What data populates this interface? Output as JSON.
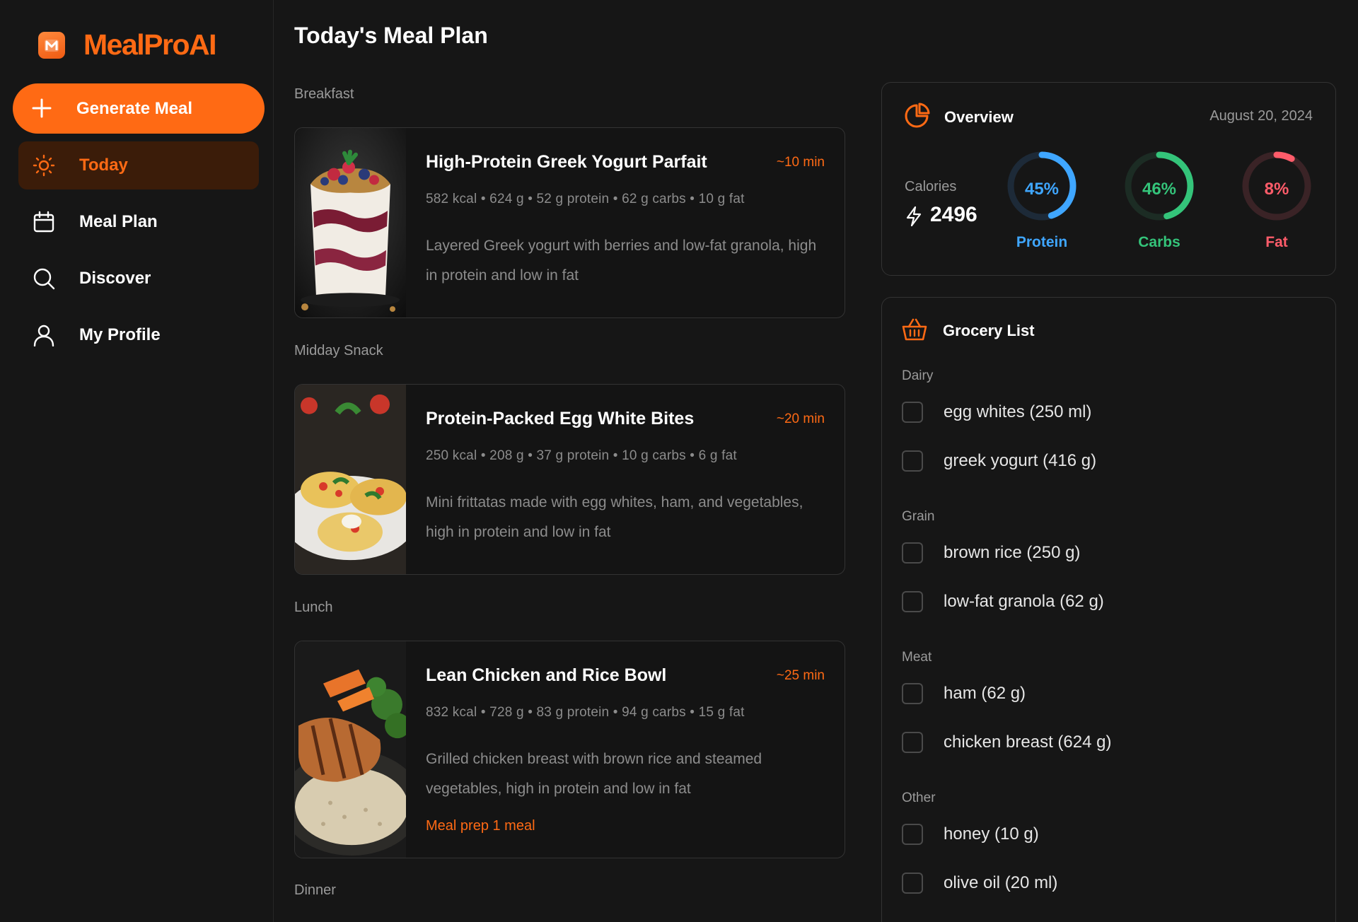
{
  "app": {
    "name": "MealProAI"
  },
  "sidebar": {
    "generate_label": "Generate Meal",
    "items": [
      {
        "label": "Today",
        "icon": "sun-icon",
        "active": true
      },
      {
        "label": "Meal Plan",
        "icon": "calendar-icon",
        "active": false
      },
      {
        "label": "Discover",
        "icon": "search-icon",
        "active": false
      },
      {
        "label": "My Profile",
        "icon": "user-icon",
        "active": false
      }
    ]
  },
  "main": {
    "title": "Today's Meal Plan",
    "sections": [
      {
        "label": "Breakfast",
        "meal": {
          "name": "High-Protein Greek Yogurt Parfait",
          "time": "~10 min",
          "stats": "582 kcal • 624 g • 52 g protein • 62 g carbs • 10 g fat",
          "desc": "Layered Greek yogurt with berries and low-fat granola, high in protein and low in fat",
          "image": "yogurt-parfait-image"
        }
      },
      {
        "label": "Midday Snack",
        "meal": {
          "name": "Protein-Packed Egg White Bites",
          "time": "~20 min",
          "stats": "250 kcal • 208 g • 37 g protein • 10 g carbs • 6 g fat",
          "desc": "Mini frittatas made with egg whites, ham, and vegetables, high in protein and low in fat",
          "image": "egg-white-bites-image"
        }
      },
      {
        "label": "Lunch",
        "meal": {
          "name": "Lean Chicken and Rice Bowl",
          "time": "~25 min",
          "stats": "832 kcal • 728 g • 83 g protein • 94 g carbs • 15 g fat",
          "desc": "Grilled chicken breast with brown rice and steamed vegetables, high in protein and low in fat",
          "prep": "Meal prep 1 meal",
          "image": "chicken-rice-bowl-image"
        }
      },
      {
        "label": "Dinner"
      }
    ]
  },
  "overview": {
    "title": "Overview",
    "date": "August 20, 2024",
    "calories_label": "Calories",
    "calories": "2496",
    "macros": [
      {
        "pct_text": "45%",
        "label": "Protein",
        "fraction": 0.45,
        "color": "#3fa6ff",
        "track": "#1d2a38"
      },
      {
        "pct_text": "46%",
        "label": "Carbs",
        "fraction": 0.46,
        "color": "#34c47a",
        "track": "#1c2c24"
      },
      {
        "pct_text": "8%",
        "label": "Fat",
        "fraction": 0.08,
        "color": "#ff5c6a",
        "track": "#3a2326"
      }
    ]
  },
  "grocery": {
    "title": "Grocery List",
    "categories": [
      {
        "name": "Dairy",
        "items": [
          "egg whites (250 ml)",
          "greek yogurt (416 g)"
        ]
      },
      {
        "name": "Grain",
        "items": [
          "brown rice (250 g)",
          "low-fat granola (62 g)"
        ]
      },
      {
        "name": "Meat",
        "items": [
          "ham (62 g)",
          "chicken breast (624 g)"
        ]
      },
      {
        "name": "Other",
        "items": [
          "honey (10 g)",
          "olive oil (20 ml)"
        ]
      }
    ]
  },
  "colors": {
    "accent": "#ff6a14",
    "background": "#161616",
    "active_nav": "#3b1c09"
  }
}
